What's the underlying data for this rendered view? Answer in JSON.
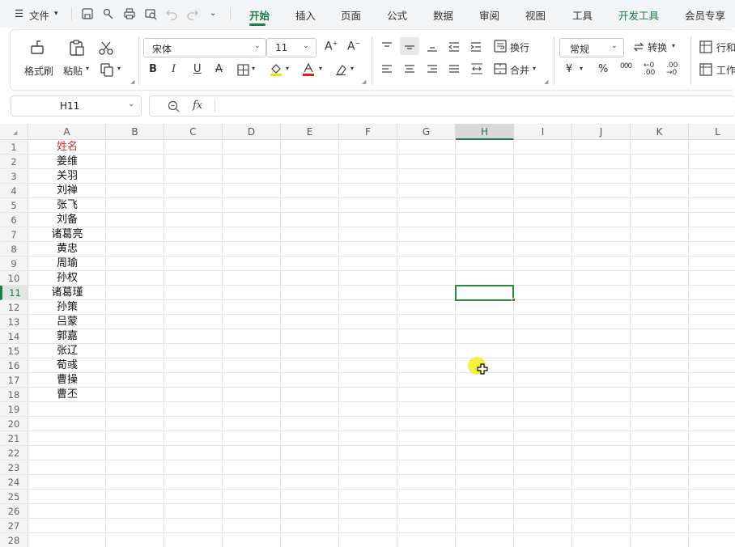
{
  "menu": {
    "file_label": "文件",
    "tabs": [
      {
        "label": "开始",
        "active": true
      },
      {
        "label": "插入"
      },
      {
        "label": "页面"
      },
      {
        "label": "公式"
      },
      {
        "label": "数据"
      },
      {
        "label": "审阅"
      },
      {
        "label": "视图"
      },
      {
        "label": "工具"
      },
      {
        "label": "开发工具",
        "highlight": true
      },
      {
        "label": "会员专享"
      }
    ]
  },
  "ribbon": {
    "format_painter": "格式刷",
    "paste": "粘贴",
    "font_name": "宋体",
    "font_size": "11",
    "wrap": "换行",
    "merge": "合并",
    "number_format": "常规",
    "convert": "转换",
    "rows_cols": "行和",
    "worksheet": "工作",
    "bold": "B",
    "italic": "I",
    "underline": "U",
    "strike": "A",
    "yen": "¥",
    "percent": "%",
    "thousands": "000"
  },
  "formula_bar": {
    "name_box": "H11",
    "fx": "fx",
    "formula": ""
  },
  "sheet": {
    "columns": [
      "A",
      "B",
      "C",
      "D",
      "E",
      "F",
      "G",
      "H",
      "I",
      "J",
      "K",
      "L"
    ],
    "selected_column": "H",
    "selected_row": 11,
    "rows": [
      1,
      2,
      3,
      4,
      5,
      6,
      7,
      8,
      9,
      10,
      11,
      12,
      13,
      14,
      15,
      16,
      17,
      18,
      19,
      20,
      21,
      22,
      23,
      24,
      25,
      26,
      27,
      28
    ],
    "column_a": [
      "姓名",
      "姜维",
      "关羽",
      "刘禅",
      "张飞",
      "刘备",
      "诸葛亮",
      "黄忠",
      "周瑜",
      "孙权",
      "诸葛瑾",
      "孙策",
      "吕蒙",
      "郭嘉",
      "张辽",
      "荀彧",
      "曹操",
      "曹丕"
    ],
    "header_color": "#c0392b",
    "accent_color": "#1f7a4a"
  }
}
